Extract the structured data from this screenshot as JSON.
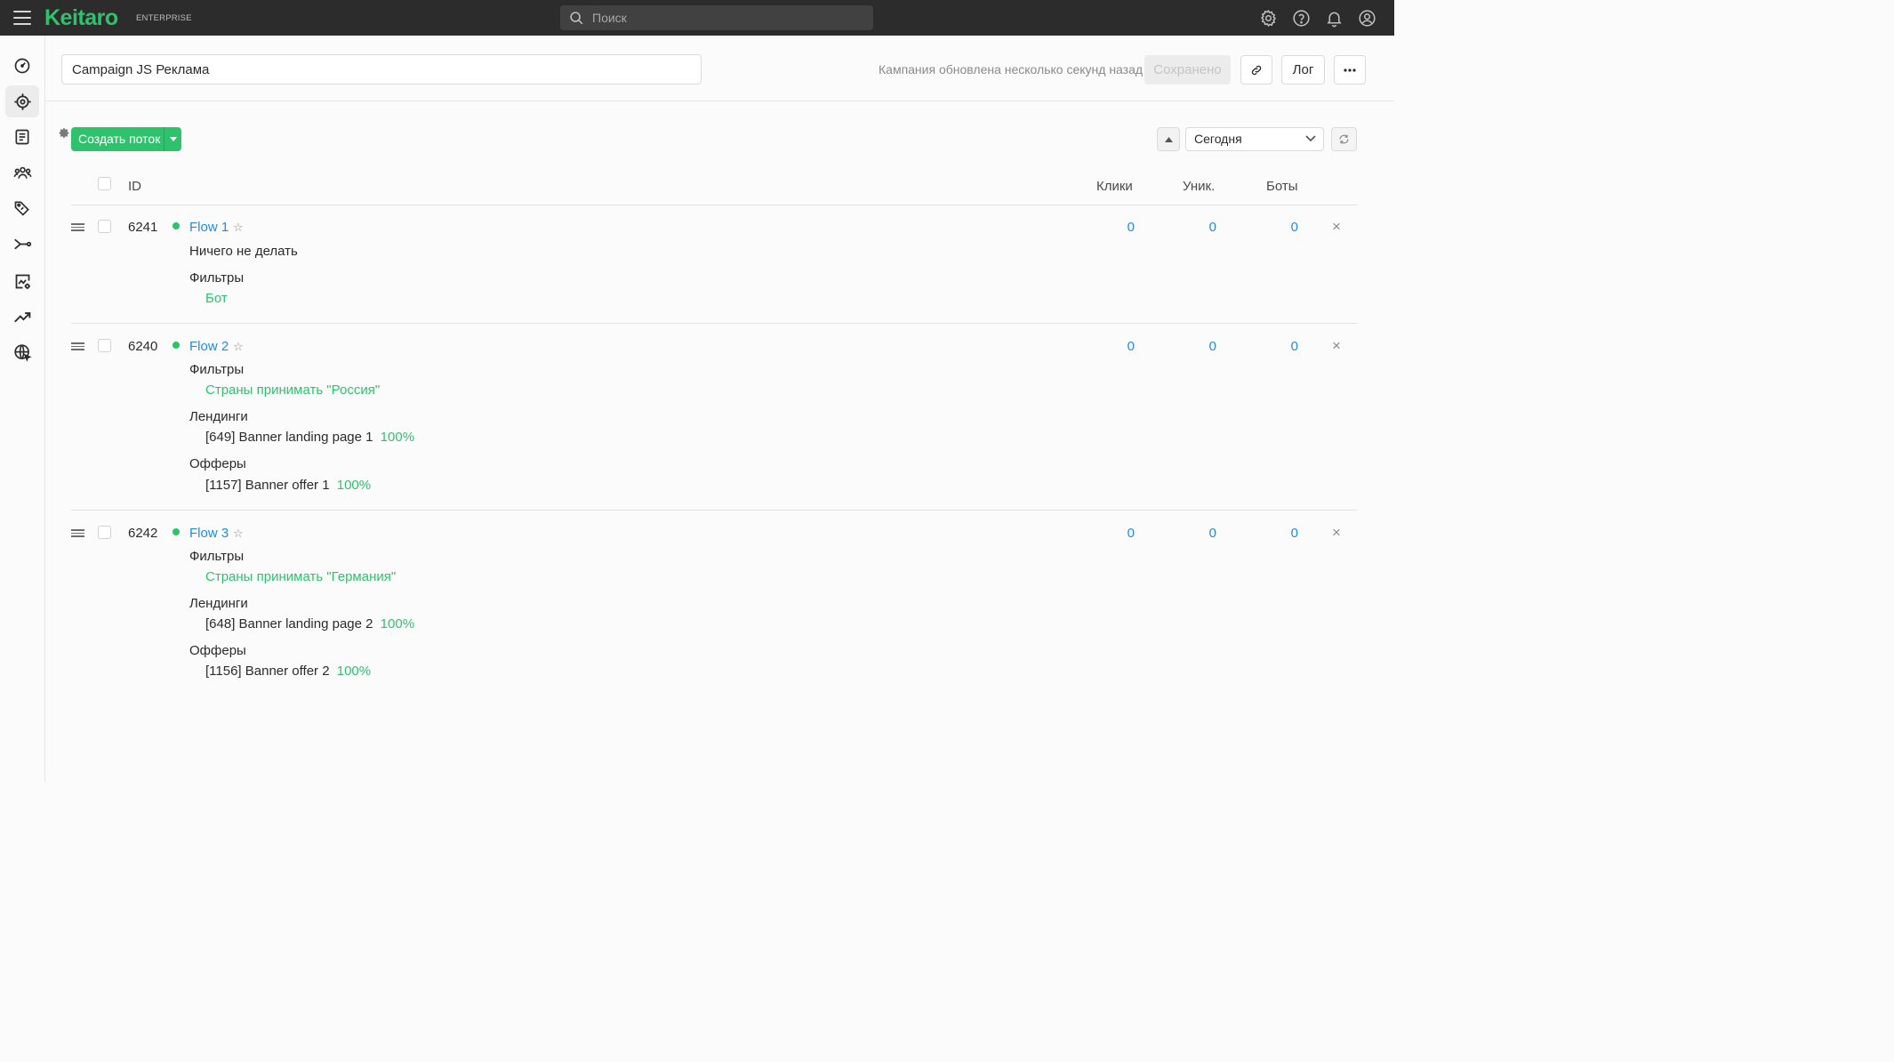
{
  "topbar": {
    "brand": "Keitaro",
    "edition": "ENTERPRISE",
    "search_placeholder": "Поиск",
    "icons": [
      "gear-icon",
      "help-icon",
      "bell-icon",
      "user-icon"
    ]
  },
  "sidebar": {
    "items": [
      {
        "icon": "dashboard-icon",
        "active": false
      },
      {
        "icon": "campaigns-target-icon",
        "active": true
      },
      {
        "icon": "landing-pages-icon",
        "active": false
      },
      {
        "icon": "users-icon",
        "active": false
      },
      {
        "icon": "offers-tag-icon",
        "active": false
      },
      {
        "icon": "streams-route-icon",
        "active": false
      },
      {
        "icon": "reports-chart-icon",
        "active": false
      },
      {
        "icon": "trends-icon",
        "active": false
      },
      {
        "icon": "domains-globe-icon",
        "active": false
      }
    ]
  },
  "header": {
    "campaign_name": "Campaign JS Реклама",
    "updated_text": "Кампания обновлена несколько секунд назад",
    "saved_label": "Сохранено",
    "log_label": "Лог"
  },
  "toolbar": {
    "create_label": "Создать поток",
    "date_range": "Сегодня"
  },
  "table": {
    "columns": {
      "id": "ID",
      "clicks": "Клики",
      "unique": "Уник.",
      "bots": "Боты"
    },
    "rows": [
      {
        "id": "6241",
        "name": "Flow 1",
        "clicks": "0",
        "unique": "0",
        "bots": "0",
        "action": "Ничего не делать",
        "filters_title": "Фильтры",
        "filter": "Бот"
      },
      {
        "id": "6240",
        "name": "Flow 2",
        "clicks": "0",
        "unique": "0",
        "bots": "0",
        "filters_title": "Фильтры",
        "filter": "Страны принимать \"Россия\"",
        "landings_title": "Лендинги",
        "landing": "[649] Banner landing page 1",
        "landing_share": "100%",
        "offers_title": "Офферы",
        "offer": "[1157] Banner offer 1",
        "offer_share": "100%"
      },
      {
        "id": "6242",
        "name": "Flow 3",
        "clicks": "0",
        "unique": "0",
        "bots": "0",
        "filters_title": "Фильтры",
        "filter": "Страны принимать \"Германия\"",
        "landings_title": "Лендинги",
        "landing": "[648] Banner landing page 2",
        "landing_share": "100%",
        "offers_title": "Офферы",
        "offer": "[1156] Banner offer 2",
        "offer_share": "100%"
      }
    ]
  },
  "colors": {
    "accent": "#2fc26d",
    "link": "#1f8ce6",
    "topbar": "#2c2c2c"
  }
}
